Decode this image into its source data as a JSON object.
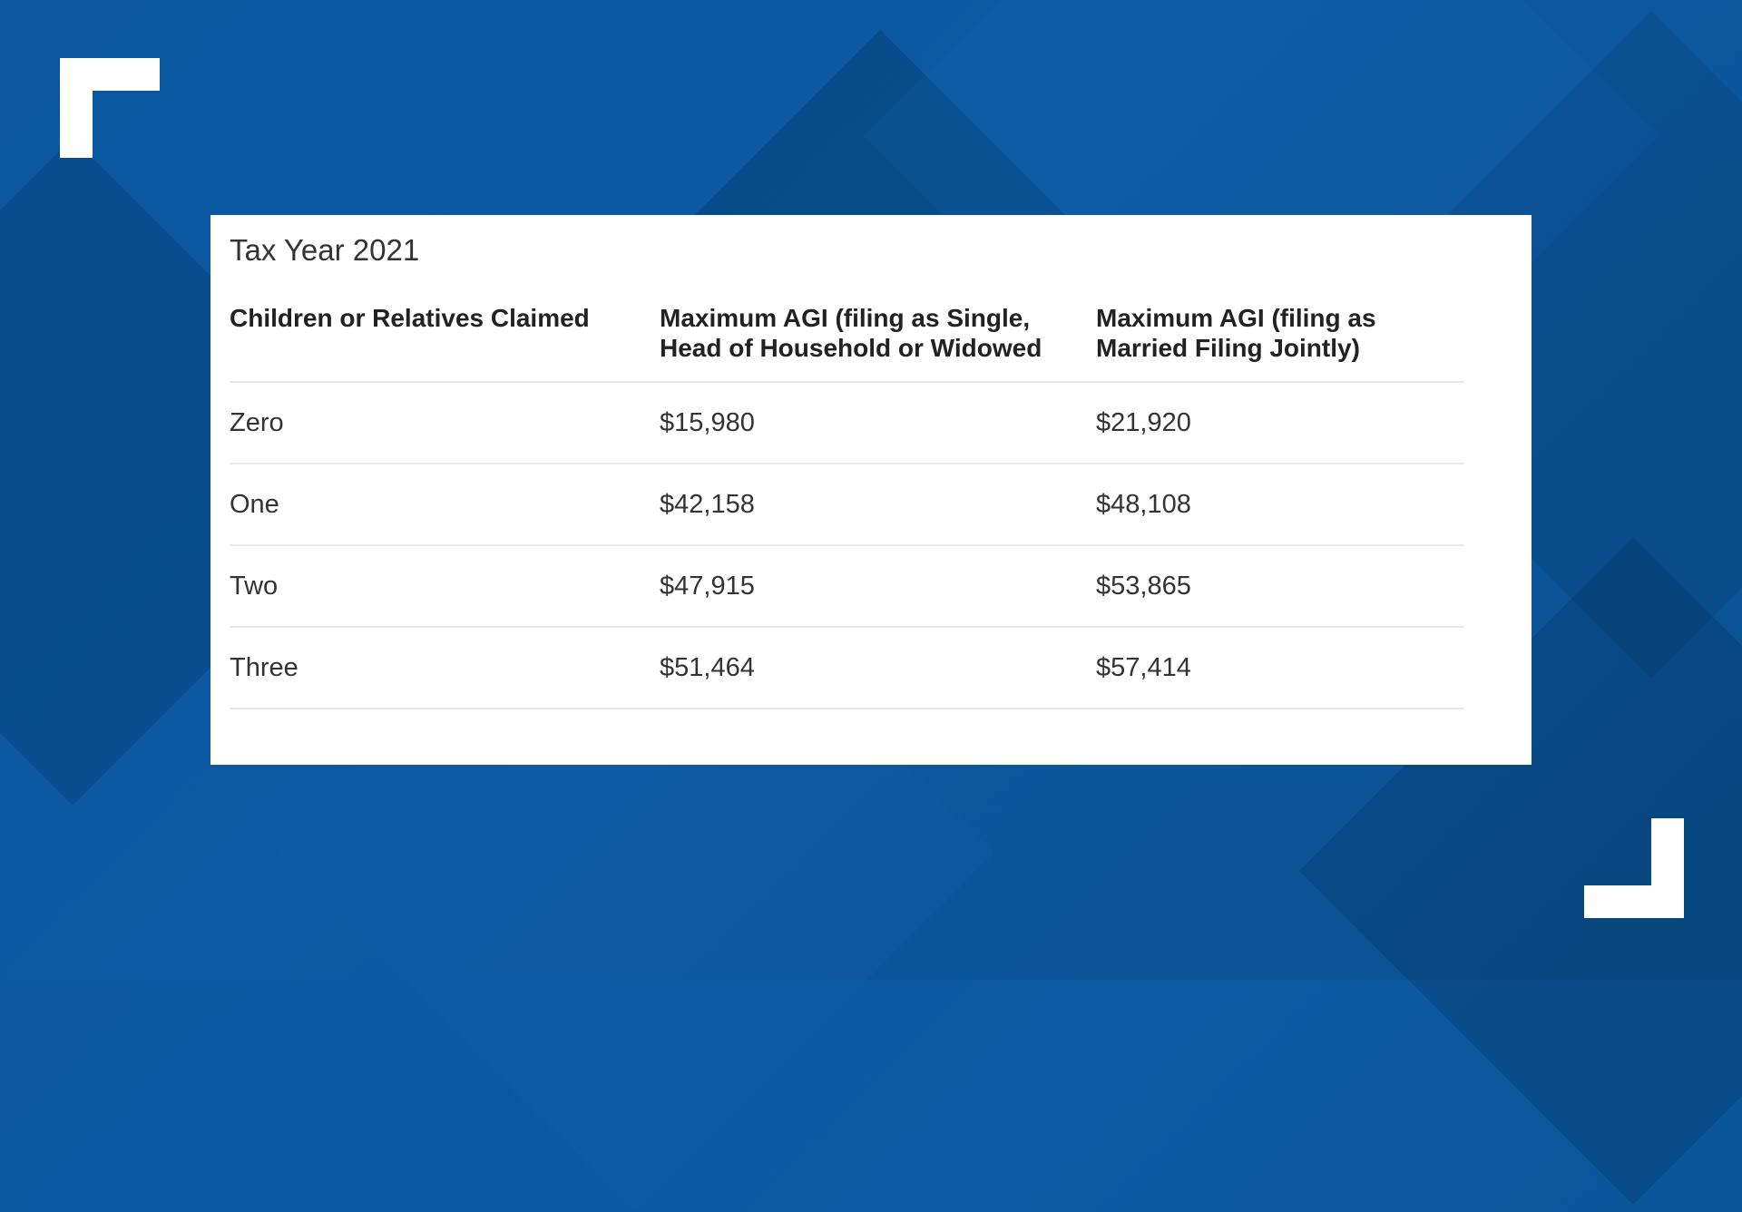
{
  "card": {
    "title": "Tax Year 2021"
  },
  "table": {
    "headers": [
      "Children or Relatives Claimed",
      "Maximum AGI (filing as Single, Head of Household or Widowed",
      "Maximum AGI (filing as Married Filing Jointly)"
    ],
    "rows": [
      [
        "Zero",
        "$15,980",
        "$21,920"
      ],
      [
        "One",
        "$42,158",
        "$48,108"
      ],
      [
        "Two",
        "$47,915",
        "$53,865"
      ],
      [
        "Three",
        "$51,464",
        "$57,414"
      ]
    ]
  },
  "colors": {
    "background": "#0a57a0",
    "card": "#ffffff",
    "corner_brackets": "#ffffff"
  }
}
